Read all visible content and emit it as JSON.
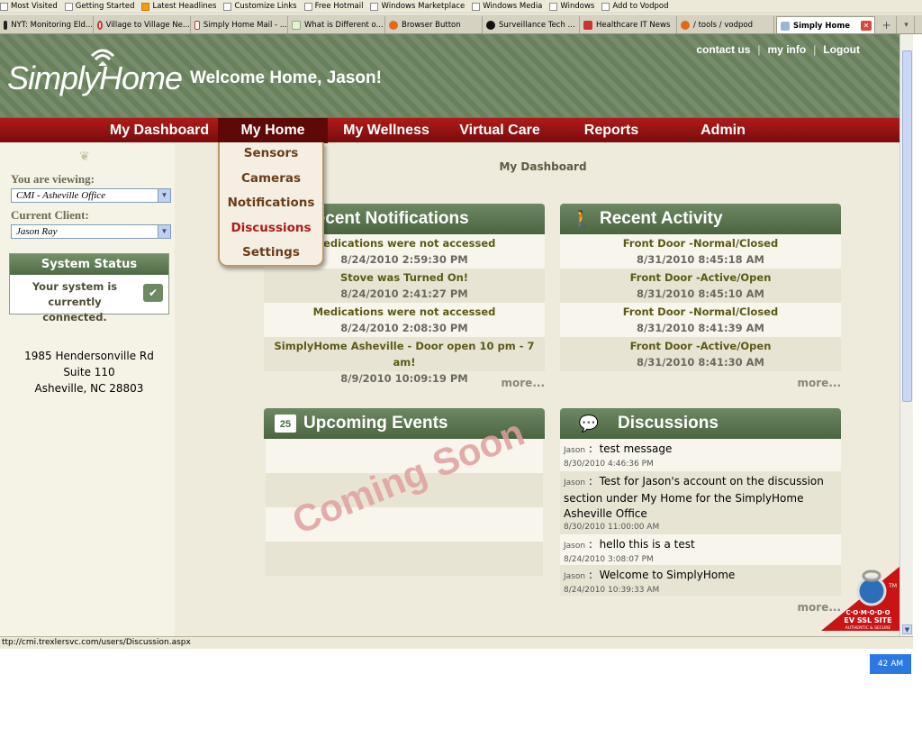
{
  "bookmarks": [
    {
      "label": "Most Visited"
    },
    {
      "label": "Getting Started"
    },
    {
      "label": "Latest Headlines"
    },
    {
      "label": "Customize Links"
    },
    {
      "label": "Free Hotmail"
    },
    {
      "label": "Windows Marketplace"
    },
    {
      "label": "Windows Media"
    },
    {
      "label": "Windows"
    },
    {
      "label": "Add to Vodpod"
    }
  ],
  "tabs": [
    {
      "label": "NYT: Monitoring Eld..."
    },
    {
      "label": "Village to Village Ne..."
    },
    {
      "label": "Simply Home Mail - ..."
    },
    {
      "label": "What is Different o..."
    },
    {
      "label": "Browser Button"
    },
    {
      "label": "Surveillance Tech ..."
    },
    {
      "label": "Healthcare IT News"
    },
    {
      "label": "/ tools / vodpod"
    },
    {
      "label": "Simply Home"
    }
  ],
  "header": {
    "logo": "SimplyHome",
    "welcome": "Welcome Home, Jason!",
    "links": {
      "contact": "contact us",
      "myinfo": "my info",
      "logout": "Logout",
      "sep": "|"
    }
  },
  "nav": {
    "dashboard": "My Dashboard",
    "home": "My Home",
    "wellness": "My Wellness",
    "virtual": "Virtual Care",
    "reports": "Reports",
    "admin": "Admin"
  },
  "dropdown": {
    "sensors": "Sensors",
    "cameras": "Cameras",
    "notifications": "Notifications",
    "discussions": "Discussions",
    "settings": "Settings"
  },
  "left": {
    "viewing_label": "You are viewing:",
    "viewing_value": "CMI - Asheville Office",
    "client_label": "Current Client:",
    "client_value": "Jason Ray",
    "status_title": "System Status",
    "status_text": "Your system is currently connected.",
    "address": [
      "1985 Hendersonville Rd",
      "Suite 110",
      "Asheville, NC 28803"
    ]
  },
  "main": {
    "title": "My Dashboard",
    "notifications": {
      "title": "Recent Notifications",
      "items": [
        {
          "text": "Medications were not accessed",
          "date": "8/24/2010 2:59:30 PM"
        },
        {
          "text": "Stove was Turned On!",
          "date": "8/24/2010 2:41:27 PM"
        },
        {
          "text": "Medications were not accessed",
          "date": "8/24/2010 2:08:30 PM"
        },
        {
          "text": "SimplyHome Asheville - Door open 10 pm - 7 am!",
          "date": "8/9/2010 10:09:19 PM"
        }
      ],
      "more": "more..."
    },
    "activity": {
      "title": "Recent Activity",
      "items": [
        {
          "text": "Front Door -Normal/Closed",
          "date": "8/31/2010 8:45:18 AM"
        },
        {
          "text": "Front Door -Active/Open",
          "date": "8/31/2010 8:45:10 AM"
        },
        {
          "text": "Front Door -Normal/Closed",
          "date": "8/31/2010 8:41:39 AM"
        },
        {
          "text": "Front Door -Active/Open",
          "date": "8/31/2010 8:41:30 AM"
        }
      ],
      "more": "more..."
    },
    "events": {
      "title": "Upcoming Events",
      "icon_day": "25",
      "overlay": "Coming Soon"
    },
    "discussions": {
      "title": "Discussions",
      "items": [
        {
          "author": "Jason",
          "text": "test message",
          "date": "8/30/2010 4:46:36 PM"
        },
        {
          "author": "Jason",
          "text": "Test for Jason's account on the discussion section under My Home for the SimplyHome Asheville Office",
          "date": "8/30/2010 11:00:00 AM"
        },
        {
          "author": "Jason",
          "text": "hello this is a test",
          "date": "8/24/2010 3:08:07 PM"
        },
        {
          "author": "Jason",
          "text": "Welcome to SimplyHome",
          "date": "8/24/2010 10:39:33 AM"
        }
      ],
      "more": "more..."
    }
  },
  "comodo": {
    "line1": "C·O·M·O·D·O",
    "line2": "EV SSL SITE",
    "line3": "AUTHENTIC & SECURE",
    "tm": "TM"
  },
  "statusbar": {
    "url": "ttp://cmi.trexlersvc.com/users/Discussion.aspx"
  },
  "taskbar": {
    "clock": "42 AM"
  },
  "colors": {
    "nav_red": "#9c1414",
    "header_green": "#6d8561",
    "panel_green": "#5a7550"
  }
}
